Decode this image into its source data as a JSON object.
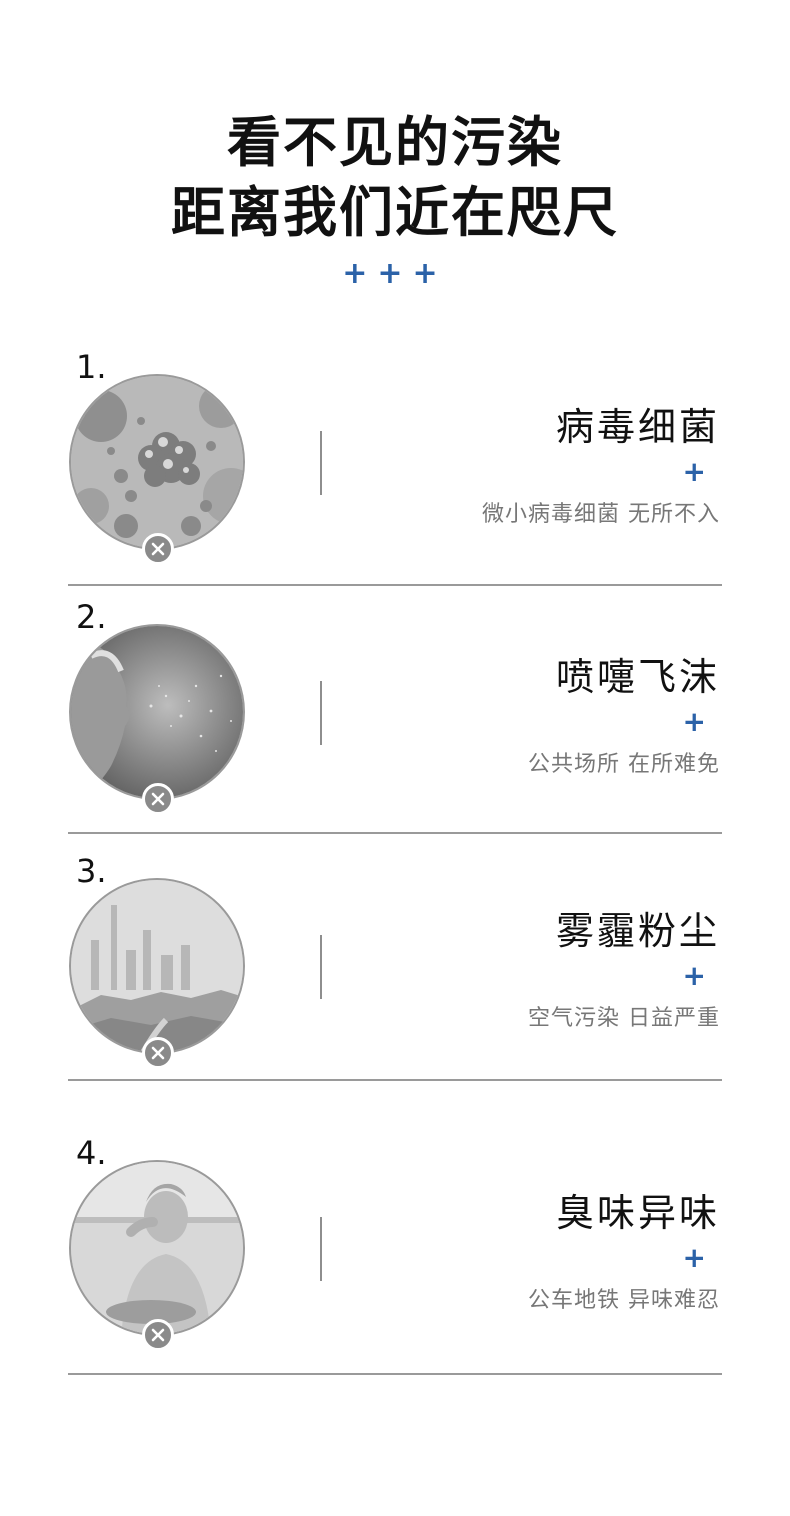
{
  "header": {
    "title_line1": "看不见的污染",
    "title_line2": "距离我们近在咫尺",
    "decoration": "+++"
  },
  "accent_color": "#2b62a8",
  "items": [
    {
      "number": "1.",
      "title": "病毒细菌",
      "plus": "+",
      "subtitle": "微小病毒细菌 无所不入",
      "image": "bacteria-photo",
      "badge_icon": "close-icon"
    },
    {
      "number": "2.",
      "title": "喷嚏飞沫",
      "plus": "+",
      "subtitle": "公共场所 在所难免",
      "image": "sneeze-photo",
      "badge_icon": "close-icon"
    },
    {
      "number": "3.",
      "title": "雾霾粉尘",
      "plus": "+",
      "subtitle": "空气污染 日益严重",
      "image": "smog-city-photo",
      "badge_icon": "close-icon"
    },
    {
      "number": "4.",
      "title": "臭味异味",
      "plus": "+",
      "subtitle": "公车地铁 异味难忍",
      "image": "bad-smell-photo",
      "badge_icon": "close-icon"
    }
  ]
}
